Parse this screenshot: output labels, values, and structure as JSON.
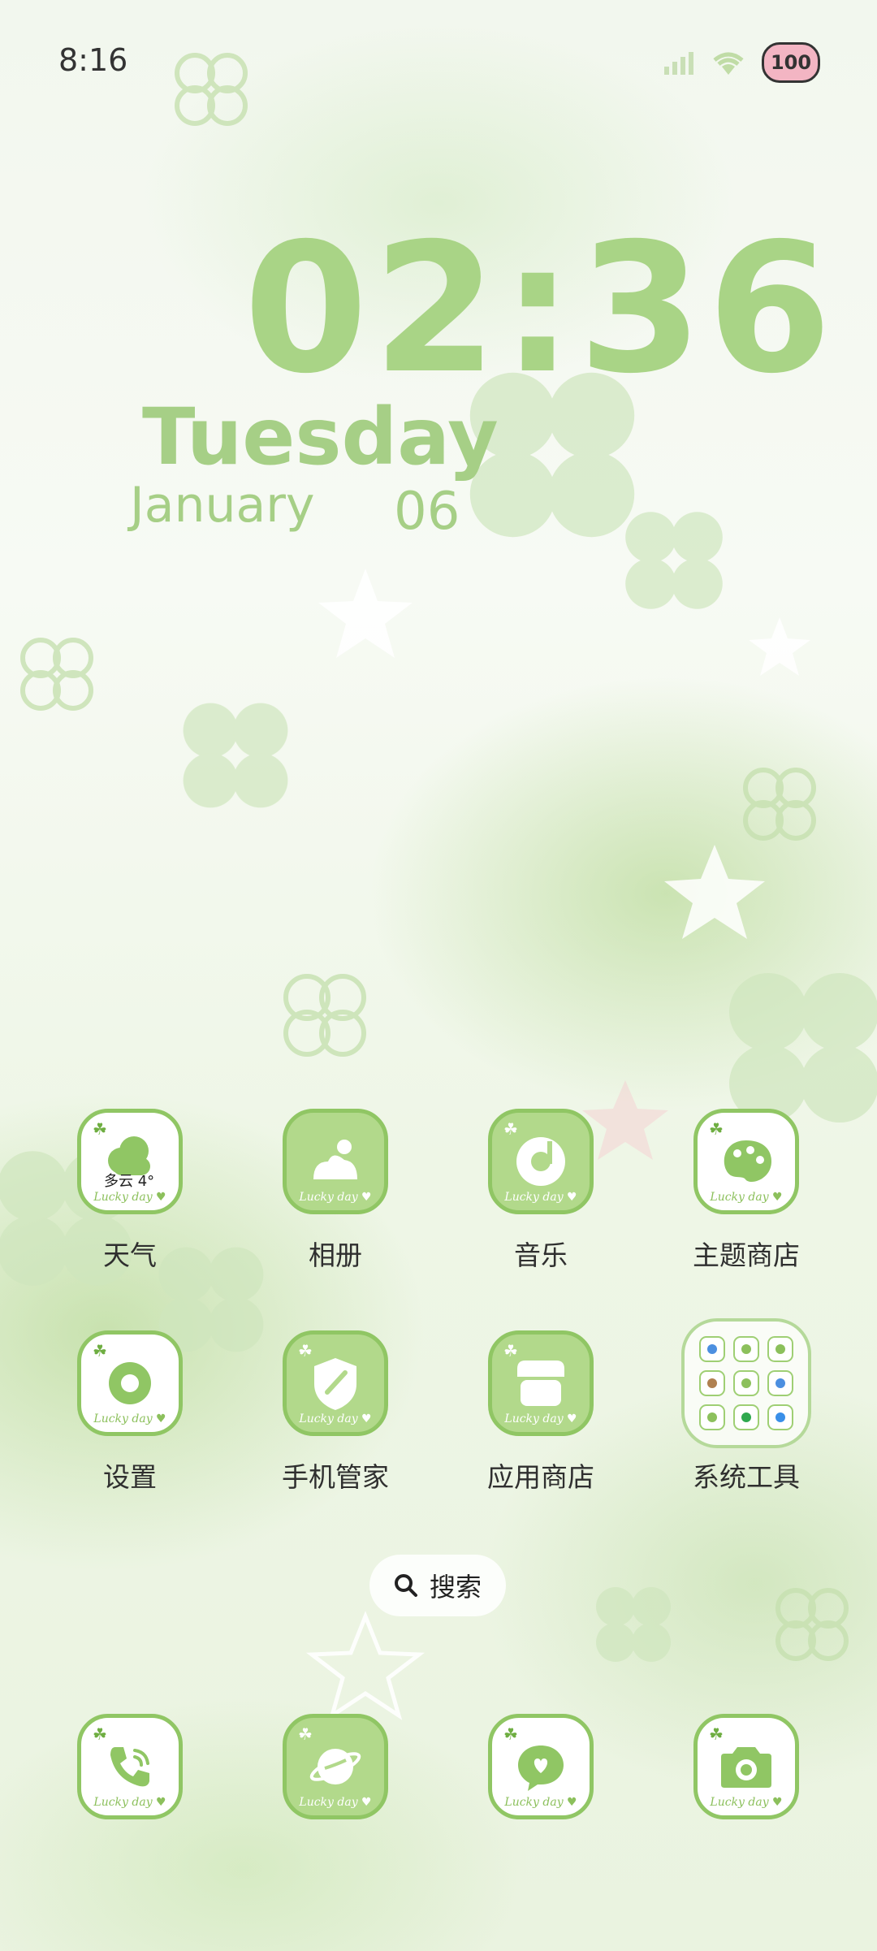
{
  "status_bar": {
    "time": "8:16",
    "battery_badge": "100"
  },
  "clock": {
    "time": "02:36",
    "weekday": "Tuesday",
    "month": "January",
    "date": "06"
  },
  "theme": {
    "lucky_text": "Lucky day ♥",
    "accent": "#90c664",
    "light_green": "#b2d98b"
  },
  "weather_widget_text": "多云 4°",
  "apps": [
    {
      "label": "天气",
      "icon": "weather-cloud-icon"
    },
    {
      "label": "相册",
      "icon": "gallery-icon"
    },
    {
      "label": "音乐",
      "icon": "music-disc-icon"
    },
    {
      "label": "主题商店",
      "icon": "palette-icon"
    },
    {
      "label": "设置",
      "icon": "settings-gear-icon"
    },
    {
      "label": "手机管家",
      "icon": "shield-icon"
    },
    {
      "label": "应用商店",
      "icon": "store-icon"
    },
    {
      "label": "系统工具",
      "icon": "folder-icon"
    }
  ],
  "search": {
    "label": "搜索"
  },
  "dock": [
    {
      "name": "phone",
      "icon": "phone-icon"
    },
    {
      "name": "browser",
      "icon": "planet-browser-icon"
    },
    {
      "name": "messages",
      "icon": "message-bubble-icon"
    },
    {
      "name": "camera",
      "icon": "camera-icon"
    }
  ]
}
